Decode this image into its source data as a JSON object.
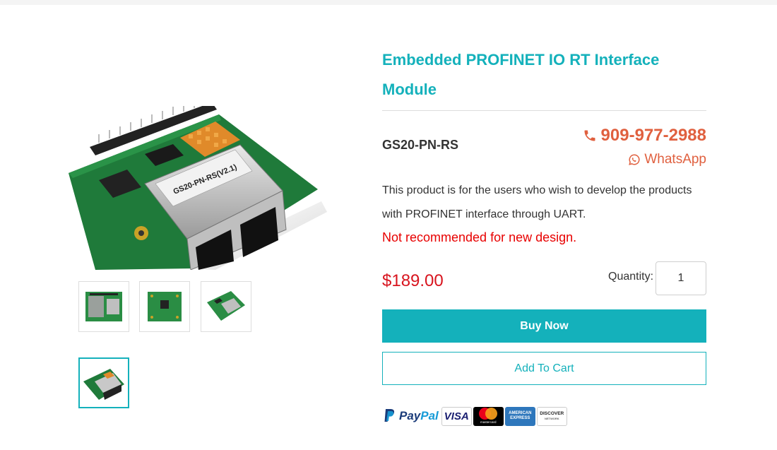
{
  "product": {
    "title": "Embedded PROFINET IO RT Interface Module",
    "sku": "GS20-PN-RS",
    "description": "This product is for the users who wish to develop the products with PROFINET interface through UART.",
    "warning": "Not recommended for new design.",
    "price": "$189.00",
    "board_label": "GS20-PN-RS(V2.1)"
  },
  "contact": {
    "phone": "909-977-2988",
    "whatsapp_label": "WhatsApp"
  },
  "purchase": {
    "quantity_label": "Quantity:",
    "quantity_value": "1",
    "buy_now_label": "Buy Now",
    "add_to_cart_label": "Add To Cart"
  },
  "payments": {
    "paypal_a": "Pay",
    "paypal_b": "Pal",
    "visa": "VISA",
    "mastercard": "mastercard",
    "amex": "AMERICAN EXPRESS",
    "discover": "DISCOVER",
    "discover_sub": "NETWORK"
  },
  "gallery": {
    "thumbnails": [
      "thumbnail-top-view",
      "thumbnail-back-view",
      "thumbnail-angle-view",
      "thumbnail-main-view"
    ],
    "active_index": 3
  },
  "colors": {
    "accent": "#14b1bb",
    "phone": "#e0603f",
    "warning": "#e80000",
    "price": "#d8141e"
  }
}
